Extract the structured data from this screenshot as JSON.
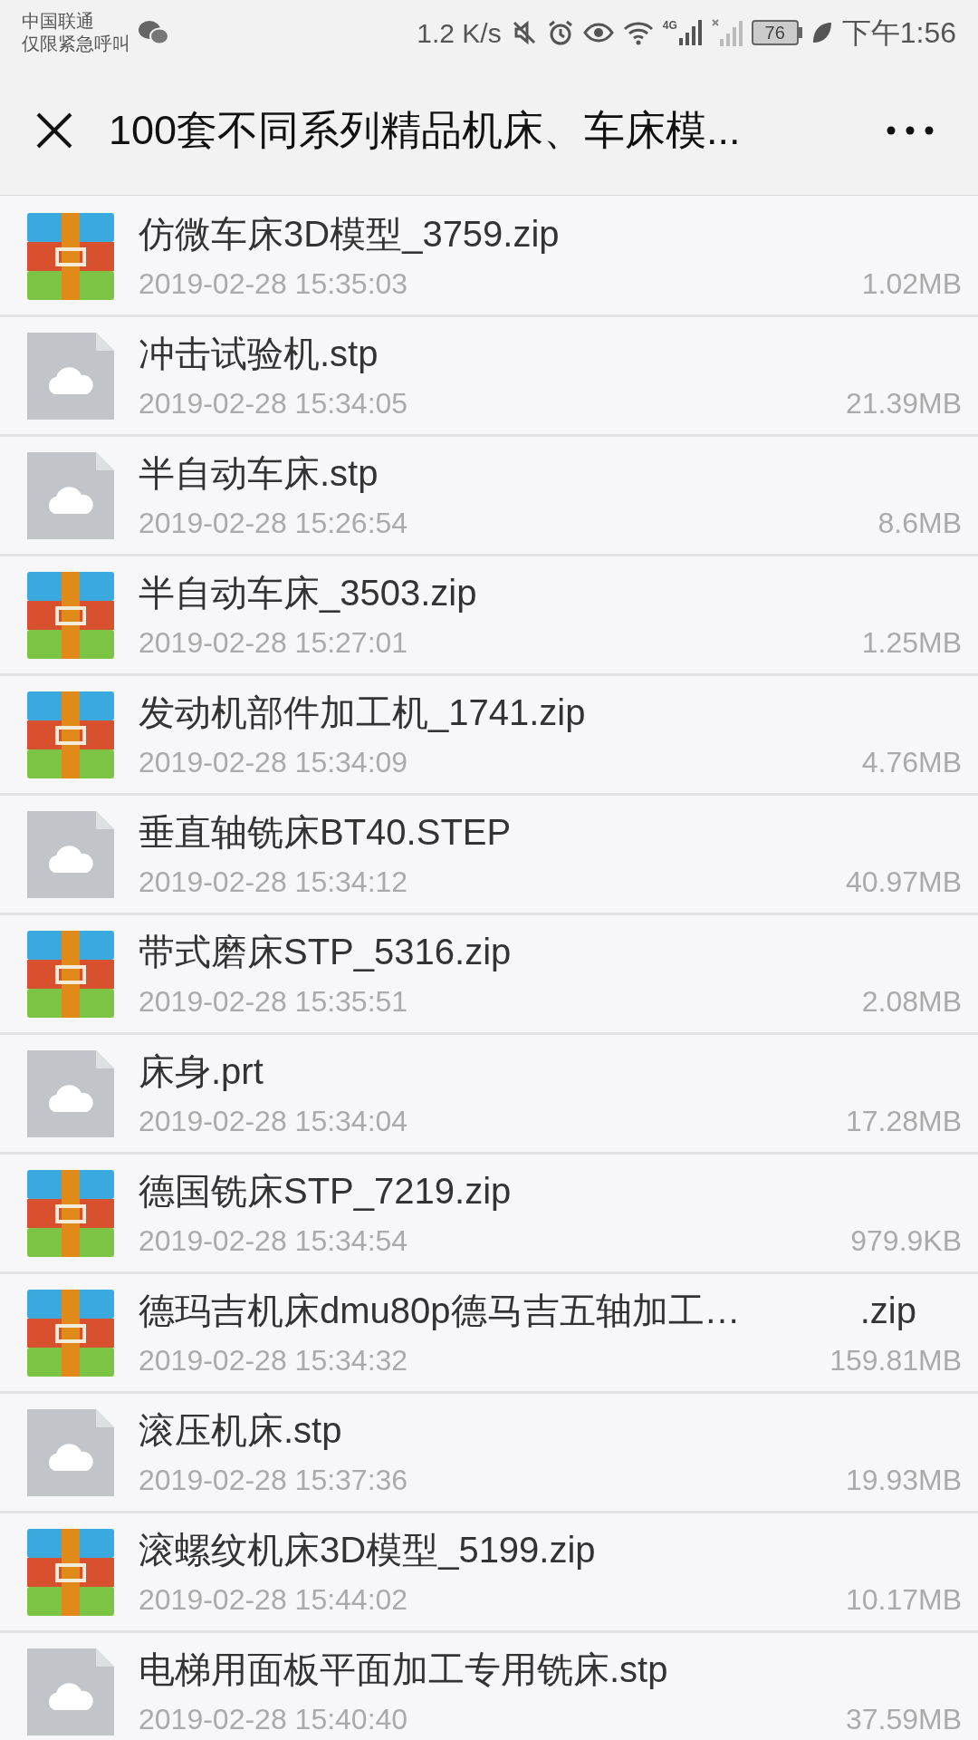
{
  "status_bar": {
    "carrier": "中国联通",
    "carrier_note": "仅限紧急呼叫",
    "speed": "1.2 K/s",
    "network": "4G",
    "battery": "76",
    "time": "下午1:56"
  },
  "header": {
    "title": "100套不同系列精品机床、车床模..."
  },
  "files": [
    {
      "kind": "zip",
      "name": "仿微车床3D模型_3759.zip",
      "date": "2019-02-28 15:35:03",
      "size": "1.02MB"
    },
    {
      "kind": "file",
      "name": "冲击试验机.stp",
      "date": "2019-02-28 15:34:05",
      "size": "21.39MB"
    },
    {
      "kind": "file",
      "name": "半自动车床.stp",
      "date": "2019-02-28 15:26:54",
      "size": "8.6MB"
    },
    {
      "kind": "zip",
      "name": "半自动车床_3503.zip",
      "date": "2019-02-28 15:27:01",
      "size": "1.25MB"
    },
    {
      "kind": "zip",
      "name": "发动机部件加工机_1741.zip",
      "date": "2019-02-28 15:34:09",
      "size": "4.76MB"
    },
    {
      "kind": "file",
      "name": "垂直轴铣床BT40.STEP",
      "date": "2019-02-28 15:34:12",
      "size": "40.97MB"
    },
    {
      "kind": "zip",
      "name": "带式磨床STP_5316.zip",
      "date": "2019-02-28 15:35:51",
      "size": "2.08MB"
    },
    {
      "kind": "file",
      "name": "床身.prt",
      "date": "2019-02-28 15:34:04",
      "size": "17.28MB"
    },
    {
      "kind": "zip",
      "name": "德国铣床STP_7219.zip",
      "date": "2019-02-28 15:34:54",
      "size": "979.9KB"
    },
    {
      "kind": "zip",
      "name": "德玛吉机床dmu80p德马吉五轴加工…",
      "suffix": ".zip",
      "date": "2019-02-28 15:34:32",
      "size": "159.81MB"
    },
    {
      "kind": "file",
      "name": "滚压机床.stp",
      "date": "2019-02-28 15:37:36",
      "size": "19.93MB"
    },
    {
      "kind": "zip",
      "name": "滚螺纹机床3D模型_5199.zip",
      "date": "2019-02-28 15:44:02",
      "size": "10.17MB"
    },
    {
      "kind": "file",
      "name": "电梯用面板平面加工专用铣床.stp",
      "date": "2019-02-28 15:40:40",
      "size": "37.59MB"
    }
  ]
}
